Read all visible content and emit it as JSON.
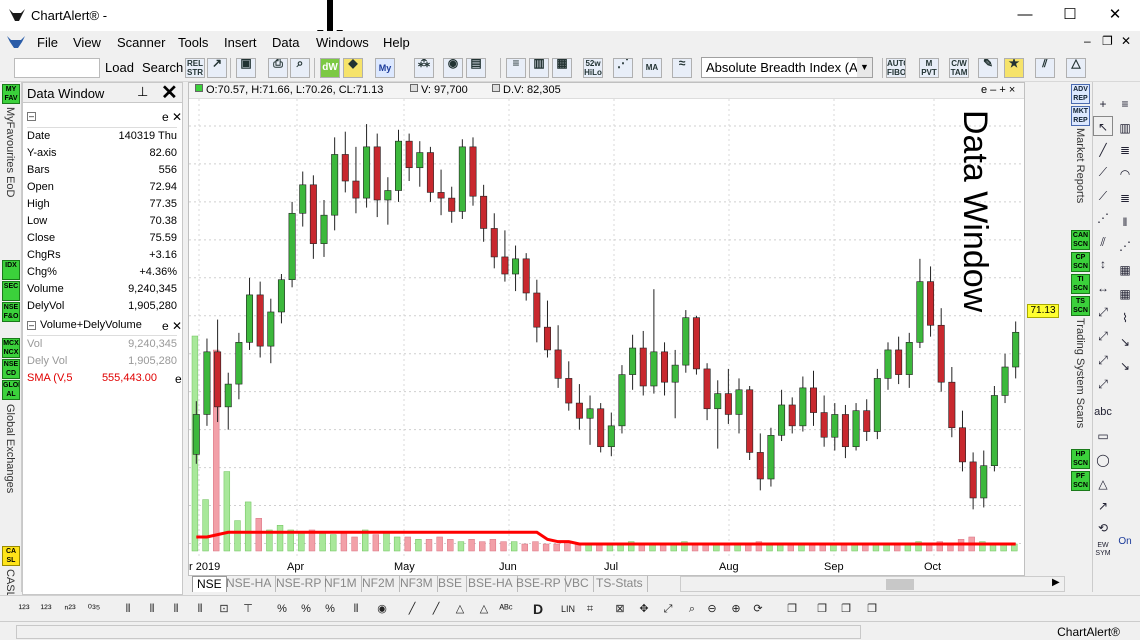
{
  "app": {
    "title": "ChartAlert® -",
    "status_text": "ChartAlert®"
  },
  "menu": [
    "File",
    "View",
    "Scanner",
    "Tools",
    "Insert",
    "Data",
    "Windows",
    "Help"
  ],
  "toolbar": {
    "load_label": "Load",
    "search_label": "Search",
    "rel_str": "REL STR",
    "dw_icon": "dW",
    "my_icon": "My",
    "w52": "52w HiLo",
    "ma_icon": "MA",
    "symbol_combo": "Absolute Breadth Index (AB",
    "auto_fibo": "AUTO FIBO",
    "m_pvt": "M PVT",
    "cw_tam": "C/W TAM",
    "tas": "TAS"
  },
  "left_strip": {
    "icons": [
      "MY FAV",
      "IDX",
      "SEC",
      "NSE F&O",
      "MCX NCX",
      "NSE CD",
      "GLOB AL",
      "CA SL"
    ],
    "labels": [
      "MyFavourites EoD",
      "Global Exchanges",
      "CASL"
    ]
  },
  "data_window": {
    "title": "Data Window",
    "pin_icon": "pin-icon",
    "section1_e": "e",
    "rows": [
      {
        "label": "Date",
        "value": "140319 Thu"
      },
      {
        "label": "Y-axis",
        "value": "82.60"
      },
      {
        "label": "Bars",
        "value": "556"
      },
      {
        "label": "Open",
        "value": "72.94"
      },
      {
        "label": "High",
        "value": "77.35"
      },
      {
        "label": "Low",
        "value": "70.38"
      },
      {
        "label": "Close",
        "value": "75.59"
      },
      {
        "label": "ChgRs",
        "value": "+3.16"
      },
      {
        "label": "Chg%",
        "value": "+4.36%"
      },
      {
        "label": "Volume",
        "value": "9,240,345"
      },
      {
        "label": "DelyVol",
        "value": "1,905,280"
      }
    ],
    "section2_title": "Volume+DelyVolume",
    "section2_e": "e",
    "rows2": [
      {
        "label": "Vol",
        "value": "9,240,345"
      },
      {
        "label": "Dely Vol",
        "value": "1,905,280"
      },
      {
        "label": "SMA (V,5",
        "value": "555,443.00",
        "e": "e"
      }
    ]
  },
  "chart_header": {
    "ohlc": "O:70.57, H:71.66, L:70.26, CL:71.13",
    "vol": "V: 97,700",
    "dv": "D.V: 82,305",
    "controls": "e – + ×"
  },
  "annotation": "Data Window",
  "price_tag": "71.13",
  "chart_data": {
    "type": "bar",
    "subtype": "candlestick with volume histogram",
    "y_ticks": [
      "82",
      "80",
      "78",
      "76",
      "74",
      "72",
      "70",
      "68",
      "66",
      "64",
      "62",
      "60"
    ],
    "ylim": [
      59.5,
      83
    ],
    "x_ticks": [
      "r 2019",
      "Apr",
      "May",
      "Jun",
      "Jul",
      "Aug",
      "Sep",
      "Oct"
    ],
    "last_close": 71.13,
    "series": [
      {
        "name": "SMA (V,5"
      }
    ],
    "candles": [
      [
        64.7,
        67.5,
        64.2,
        66.8
      ],
      [
        66.8,
        70.8,
        66.2,
        70.1
      ],
      [
        70.1,
        71.8,
        66.4,
        67.2
      ],
      [
        67.2,
        69.0,
        66.0,
        68.4
      ],
      [
        68.4,
        71.1,
        67.6,
        70.6
      ],
      [
        70.6,
        74.0,
        70.2,
        73.1
      ],
      [
        73.1,
        73.8,
        69.8,
        70.4
      ],
      [
        70.4,
        72.9,
        69.5,
        72.2
      ],
      [
        72.2,
        74.2,
        71.6,
        73.9
      ],
      [
        73.9,
        78.0,
        73.5,
        77.4
      ],
      [
        77.4,
        79.6,
        76.7,
        78.9
      ],
      [
        78.9,
        79.4,
        75.0,
        75.8
      ],
      [
        75.8,
        78.1,
        75.1,
        77.3
      ],
      [
        77.3,
        81.4,
        76.5,
        80.5
      ],
      [
        80.5,
        81.7,
        78.5,
        79.1
      ],
      [
        79.1,
        80.9,
        77.4,
        78.2
      ],
      [
        78.2,
        82.1,
        77.7,
        80.9
      ],
      [
        80.9,
        81.6,
        77.2,
        78.1
      ],
      [
        78.1,
        79.3,
        76.8,
        78.6
      ],
      [
        78.6,
        81.8,
        78.0,
        81.2
      ],
      [
        81.2,
        81.6,
        79.1,
        79.8
      ],
      [
        79.8,
        81.2,
        78.8,
        80.6
      ],
      [
        80.6,
        80.9,
        78.0,
        78.5
      ],
      [
        78.5,
        79.7,
        77.3,
        78.2
      ],
      [
        78.2,
        78.8,
        76.9,
        77.5
      ],
      [
        77.5,
        81.3,
        77.1,
        80.9
      ],
      [
        80.9,
        81.4,
        77.8,
        78.3
      ],
      [
        78.3,
        78.9,
        75.9,
        76.6
      ],
      [
        76.6,
        77.4,
        74.5,
        75.1
      ],
      [
        75.1,
        76.5,
        73.8,
        74.2
      ],
      [
        74.2,
        75.7,
        73.3,
        75.0
      ],
      [
        75.0,
        75.3,
        72.8,
        73.2
      ],
      [
        73.2,
        73.9,
        70.6,
        71.4
      ],
      [
        71.4,
        72.8,
        69.8,
        70.2
      ],
      [
        70.2,
        71.5,
        68.2,
        68.7
      ],
      [
        68.7,
        69.6,
        67.0,
        67.4
      ],
      [
        67.4,
        68.4,
        66.0,
        66.6
      ],
      [
        66.6,
        67.8,
        65.2,
        67.1
      ],
      [
        67.1,
        67.4,
        64.8,
        65.1
      ],
      [
        65.1,
        66.9,
        64.6,
        66.2
      ],
      [
        66.2,
        69.4,
        65.8,
        68.9
      ],
      [
        68.9,
        71.0,
        68.1,
        70.3
      ],
      [
        70.3,
        71.2,
        67.8,
        68.3
      ],
      [
        68.3,
        73.4,
        67.9,
        70.1
      ],
      [
        70.1,
        70.6,
        67.8,
        68.5
      ],
      [
        68.5,
        70.2,
        66.6,
        69.4
      ],
      [
        69.4,
        72.3,
        69.0,
        71.9
      ],
      [
        71.9,
        72.0,
        68.9,
        69.2
      ],
      [
        69.2,
        69.5,
        66.5,
        67.1
      ],
      [
        67.1,
        68.6,
        65.0,
        67.9
      ],
      [
        67.9,
        69.2,
        66.3,
        66.8
      ],
      [
        66.8,
        68.7,
        65.8,
        68.1
      ],
      [
        68.1,
        68.3,
        64.4,
        64.8
      ],
      [
        64.8,
        65.8,
        62.8,
        63.4
      ],
      [
        63.4,
        66.1,
        63.0,
        65.7
      ],
      [
        65.7,
        68.1,
        65.4,
        67.3
      ],
      [
        67.3,
        67.7,
        65.8,
        66.2
      ],
      [
        66.2,
        68.8,
        65.9,
        68.2
      ],
      [
        68.2,
        69.1,
        66.2,
        66.9
      ],
      [
        66.9,
        67.8,
        65.1,
        65.6
      ],
      [
        65.6,
        67.4,
        64.9,
        66.8
      ],
      [
        66.8,
        67.3,
        64.5,
        65.1
      ],
      [
        65.1,
        67.4,
        64.9,
        67.0
      ],
      [
        67.0,
        67.6,
        65.4,
        65.9
      ],
      [
        65.9,
        69.2,
        65.5,
        68.7
      ],
      [
        68.7,
        70.6,
        68.1,
        70.2
      ],
      [
        70.2,
        70.9,
        68.4,
        68.9
      ],
      [
        68.9,
        71.1,
        68.2,
        70.6
      ],
      [
        70.6,
        75.0,
        70.3,
        73.8
      ],
      [
        73.8,
        74.6,
        70.9,
        71.5
      ],
      [
        71.5,
        72.4,
        68.0,
        68.5
      ],
      [
        68.5,
        69.3,
        65.6,
        66.1
      ],
      [
        66.1,
        67.0,
        63.8,
        64.3
      ],
      [
        64.3,
        64.8,
        61.8,
        62.4
      ],
      [
        62.4,
        64.9,
        61.9,
        64.1
      ],
      [
        64.1,
        68.3,
        63.8,
        67.8
      ],
      [
        67.8,
        70.0,
        67.4,
        69.3
      ],
      [
        69.3,
        71.7,
        68.7,
        71.13
      ]
    ],
    "volume": [
      9.2,
      2.2,
      8.6,
      3.4,
      1.3,
      2.1,
      1.4,
      0.9,
      1.1,
      0.9,
      0.8,
      0.9,
      0.8,
      0.7,
      0.8,
      0.6,
      0.9,
      0.7,
      0.8,
      0.6,
      0.6,
      0.5,
      0.5,
      0.6,
      0.5,
      0.4,
      0.5,
      0.4,
      0.5,
      0.4,
      0.4,
      0.3,
      0.4,
      0.3,
      0.3,
      0.4,
      0.3,
      0.3,
      0.3,
      0.3,
      0.3,
      0.4,
      0.3,
      0.3,
      0.3,
      0.3,
      0.4,
      0.3,
      0.3,
      0.3,
      0.3,
      0.3,
      0.3,
      0.4,
      0.3,
      0.3,
      0.3,
      0.3,
      0.3,
      0.3,
      0.3,
      0.3,
      0.3,
      0.3,
      0.3,
      0.3,
      0.3,
      0.3,
      0.4,
      0.3,
      0.4,
      0.3,
      0.5,
      0.6,
      0.4,
      0.3,
      0.3,
      0.3
    ],
    "sma_volume": [
      0.6,
      0.6,
      0.7,
      0.8,
      0.8,
      0.8,
      0.8,
      0.8,
      0.8,
      0.8,
      0.8,
      0.8,
      0.8,
      0.8,
      0.8,
      0.8,
      0.8,
      0.8,
      0.8,
      0.8,
      0.8,
      0.8,
      0.8,
      0.8,
      0.8,
      0.8,
      0.8,
      0.8,
      0.8,
      0.8,
      0.8,
      0.8,
      0.8,
      0.5,
      0.4,
      0.4,
      0.3,
      0.3,
      0.3,
      0.3,
      0.3,
      0.3,
      0.3,
      0.3,
      0.3,
      0.3,
      0.3,
      0.3,
      0.3,
      0.3,
      0.3,
      0.3,
      0.3,
      0.3,
      0.3,
      0.3,
      0.3,
      0.3,
      0.3,
      0.3,
      0.3,
      0.3,
      0.3,
      0.3,
      0.3,
      0.3,
      0.3,
      0.3,
      0.3,
      0.3,
      0.3,
      0.3,
      0.3,
      0.3,
      0.3,
      0.3,
      0.3,
      0.3
    ],
    "colors": {
      "up": "#3cb83c",
      "down": "#c8282e",
      "sma": "#ff0000",
      "vol_up": "#a8e89a",
      "vol_down": "#f2a0a8"
    }
  },
  "tabs": [
    "NSE",
    "NSE-HA",
    "NSE-RP",
    "NF1M",
    "NF2M",
    "NF3M",
    "BSE",
    "BSE-HA",
    "BSE-RP",
    "VBC",
    "TS-Stats"
  ],
  "right_strip": {
    "icons": [
      "ADV REP",
      "MKT REP",
      "CAN SCN",
      "CP SCN",
      "TI SCN",
      "TS SCN",
      "HP SCN",
      "PF SCN"
    ],
    "labels": [
      "Market Reports",
      "Trading System Scans"
    ]
  },
  "draw_tools": {
    "abc": "abc",
    "on": "On",
    "ew": "EW SYM"
  },
  "bottom_toolbar": {
    "lin": "LIN"
  }
}
